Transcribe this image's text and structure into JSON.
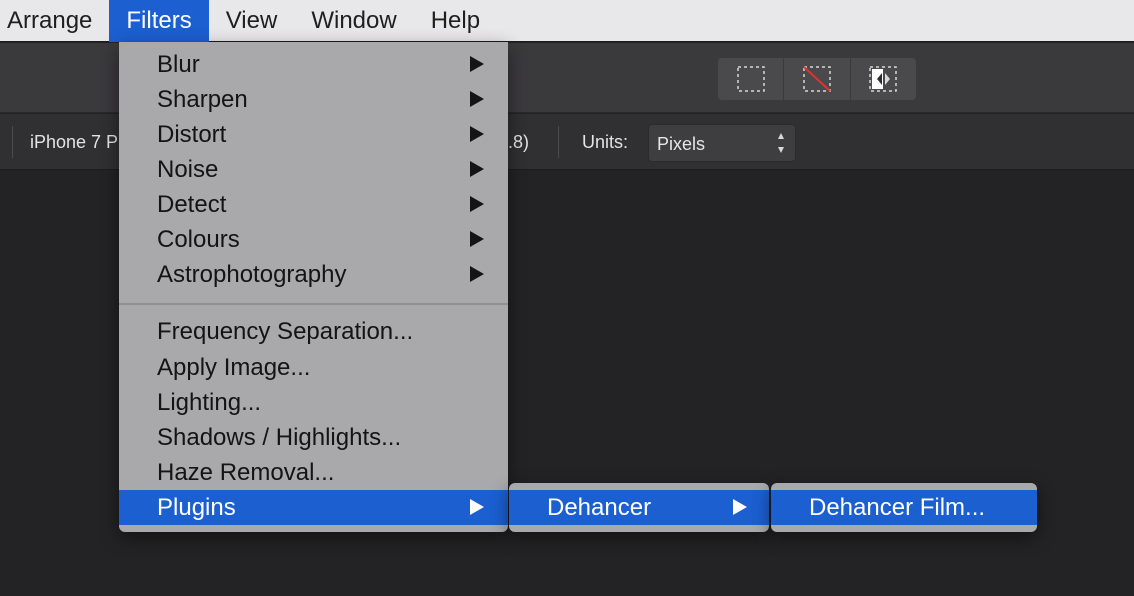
{
  "menubar": {
    "items": [
      {
        "label": "Arrange",
        "active": false
      },
      {
        "label": "Filters",
        "active": true
      },
      {
        "label": "View",
        "active": false
      },
      {
        "label": "Window",
        "active": false
      },
      {
        "label": "Help",
        "active": false
      }
    ]
  },
  "toolbar": {
    "mode_buttons": [
      {
        "icon": "marquee-selection-icon"
      },
      {
        "icon": "no-selection-icon",
        "accent": "#e0332d"
      },
      {
        "icon": "flip-selection-icon"
      }
    ]
  },
  "contextbar": {
    "document_preset": "iPhone 7 P",
    "dpi_suffix": ".8)",
    "units_label": "Units:",
    "units_value": "Pixels"
  },
  "filters_menu": {
    "group1": [
      {
        "label": "Blur",
        "has_submenu": true
      },
      {
        "label": "Sharpen",
        "has_submenu": true
      },
      {
        "label": "Distort",
        "has_submenu": true
      },
      {
        "label": "Noise",
        "has_submenu": true
      },
      {
        "label": "Detect",
        "has_submenu": true
      },
      {
        "label": "Colours",
        "has_submenu": true
      },
      {
        "label": "Astrophotography",
        "has_submenu": true
      }
    ],
    "group2": [
      {
        "label": "Frequency Separation...",
        "has_submenu": false
      },
      {
        "label": "Apply Image...",
        "has_submenu": false
      },
      {
        "label": "Lighting...",
        "has_submenu": false
      },
      {
        "label": "Shadows / Highlights...",
        "has_submenu": false
      },
      {
        "label": "Haze Removal...",
        "has_submenu": false
      },
      {
        "label": "Plugins",
        "has_submenu": true,
        "selected": true
      }
    ]
  },
  "plugins_submenu": {
    "label": "Dehancer",
    "has_submenu": true
  },
  "dehancer_submenu": {
    "label": "Dehancer Film..."
  },
  "colors": {
    "accent": "#1b5fd0",
    "menu_bg": "#a9a8ab",
    "canvas": "#232224"
  }
}
